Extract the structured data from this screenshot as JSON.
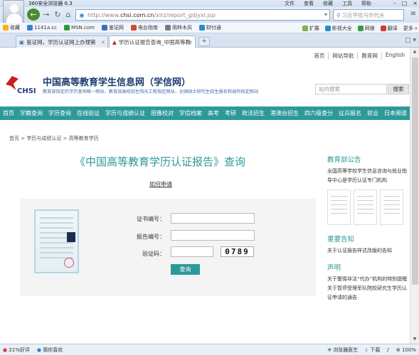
{
  "browser": {
    "app_name": "360安全浏览器 6.3",
    "menu": [
      "文件",
      "查看",
      "收藏",
      "工具",
      "帮助"
    ],
    "url_prefix": "http://www.",
    "url_domain": "chsi.com.cn",
    "url_path": "/xlrz/report_gdjyxl.jsp",
    "search_placeholder": "习近平抵马尔代夫"
  },
  "bookmarks": {
    "favorites_label": "收藏",
    "items": [
      "1141a.cc",
      "MSN.com",
      "鉴证网",
      "电台指南",
      "雨林木风",
      "财付通"
    ],
    "right": [
      "扩展",
      "影视大全",
      "网银",
      "翻译",
      "更多"
    ]
  },
  "tabs": [
    {
      "label": "鉴证网，学历认证网上办理第"
    },
    {
      "label": "学历认证报告查询_中国高等教"
    }
  ],
  "site": {
    "top_links": [
      "首页",
      "网站导航",
      "教育网",
      "English"
    ],
    "logo_text": "CHSI",
    "name": "中国高等教育学生信息网（学信网）",
    "slogan": "教育部指定的学历查询唯一网站，教育部高校招生阳光工程指定网站，全国硕士研究生招生报名和调剂指定网站",
    "search_placeholder": "站内搜索",
    "search_button": "搜索",
    "nav": [
      "首页",
      "学籍查询",
      "学历查询",
      "在线验证",
      "学历与成绩认证",
      "图像校对",
      "学信档案",
      "高考",
      "考研",
      "政法招生",
      "港澳台招生",
      "四六级查分",
      "征兵报名",
      "就业",
      "日本频道"
    ]
  },
  "breadcrumb": {
    "items": [
      "首页",
      "学历与成绩认证",
      "高等教育学历"
    ],
    "separator": ">"
  },
  "main": {
    "title": "《中国高等教育学历认证报告》查询",
    "howto_link": "如何申请",
    "form": {
      "cert_label": "证书编号：",
      "report_label": "报告编号：",
      "captcha_label": "验证码：",
      "captcha_code": "0789",
      "submit": "查询"
    }
  },
  "sidebar": {
    "notice_head": "教育部公告",
    "notice_text": "全国高等学校学生信息咨询与就业指导中心是学历认证专门机构",
    "important_head": "重要告知",
    "important_text": "关于认证报告样式改版的告知",
    "statement_head": "声明",
    "statement_items": [
      "关于警惕非法“代办”机构的特别提醒",
      "关于暂停受理军队院校研究生学历认证申请的通告"
    ]
  },
  "statusbar": {
    "left": [
      "21%好评",
      "猜你喜欢"
    ],
    "right": [
      "浏览器医生",
      "下载",
      "100%"
    ]
  }
}
